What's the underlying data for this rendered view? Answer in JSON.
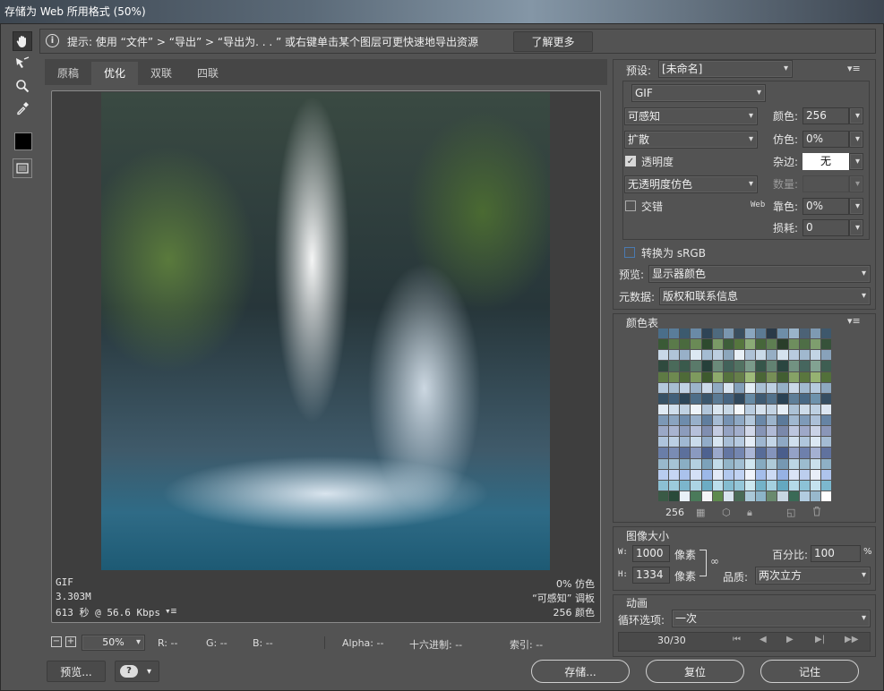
{
  "window": {
    "title": "存储为 Web 所用格式 (50%)"
  },
  "hint": {
    "text": "提示: 使用 “文件” > “导出” > “导出为. . . ” 或右键单击某个图层可更快速地导出资源",
    "learn_more": "了解更多"
  },
  "tabs": [
    "原稿",
    "优化",
    "双联",
    "四联"
  ],
  "image_info": {
    "format": "GIF",
    "size": "3.303M",
    "time": "613 秒 @ 56.6 Kbps",
    "dither": "0% 仿色",
    "palette": "“可感知” 调板",
    "colors": "256 颜色"
  },
  "statusbar": {
    "zoom": "50%",
    "r": "R: --",
    "g": "G: --",
    "b": "B: --",
    "alpha": "Alpha: --",
    "hex": "十六进制: --",
    "index": "索引: --"
  },
  "bottom_buttons": {
    "preview": "预览...",
    "save": "存储...",
    "reset": "复位",
    "remember": "记住"
  },
  "settings": {
    "preset_label": "预设:",
    "preset_value": "[未命名]",
    "format_value": "GIF",
    "reduction": "可感知",
    "dither_algo": "扩散",
    "transparency_label": "透明度",
    "transparency_checked": true,
    "trans_dither": "无透明度仿色",
    "interlace_label": "交错",
    "interlace_checked": false,
    "colors_label": "颜色:",
    "colors_value": "256",
    "dither_label": "仿色:",
    "dither_value": "0%",
    "matte_label": "杂边:",
    "matte_value": "无",
    "amount_label": "数量:",
    "amount_value": "",
    "websnap_prefix": "Web",
    "websnap_label": "靠色:",
    "websnap_value": "0%",
    "lossy_label": "损耗:",
    "lossy_value": "0",
    "convert_srgb": "转换为 sRGB",
    "convert_checked": false,
    "preview_label": "预览:",
    "preview_value": "显示器颜色",
    "metadata_label": "元数据:",
    "metadata_value": "版权和联系信息"
  },
  "color_table": {
    "title": "颜色表",
    "count": "256",
    "swatches": [
      "#4a6e8a",
      "#5a7d9a",
      "#3c5a6e",
      "#6a8aa6",
      "#2e4456",
      "#4e6a7e",
      "#7a96ae",
      "#3a4e5e",
      "#8aa6be",
      "#5c7a92",
      "#2a3a48",
      "#6e8ea8",
      "#9ab4ca",
      "#4c6276",
      "#7e9ab2",
      "#3e586c",
      "#3a5a36",
      "#5a7a4a",
      "#4a6a3e",
      "#6a8a56",
      "#2e4a2e",
      "#7a9a66",
      "#3e5e3a",
      "#56763e",
      "#8aaa76",
      "#46663a",
      "#5e7e52",
      "#2a3e2a",
      "#6e8e5e",
      "#4e6e46",
      "#7e9e6e",
      "#36523a",
      "#c8d8e8",
      "#b0c4d8",
      "#98b0c8",
      "#dce8f2",
      "#a4bcd2",
      "#bccee0",
      "#8ca6bc",
      "#e8f0f6",
      "#aec2d6",
      "#cadae8",
      "#96aec4",
      "#d4e2ee",
      "#b8cade",
      "#a0b8ce",
      "#c2d4e4",
      "#88a2ba",
      "#2f4a3e",
      "#4a6a5a",
      "#3a5a4c",
      "#5a7a6a",
      "#26403a",
      "#6a8a7a",
      "#42625a",
      "#527262",
      "#7a9a8a",
      "#36564a",
      "#628272",
      "#2a4640",
      "#729282",
      "#46665e",
      "#82a292",
      "#3e5e52",
      "#5e7a44",
      "#6e8a50",
      "#4e6a38",
      "#7e9a5e",
      "#3e5a2e",
      "#8eaa6c",
      "#56723e",
      "#667e4a",
      "#9eba7a",
      "#4a6636",
      "#768e56",
      "#425e32",
      "#86a266",
      "#5a763e",
      "#96b272",
      "#52703a",
      "#b4c8dc",
      "#a8bed2",
      "#c0d2e4",
      "#9cb4ca",
      "#ccdaea",
      "#90aac2",
      "#d8e4f0",
      "#84a0ba",
      "#e4eef6",
      "#aac0d4",
      "#bed0e2",
      "#96b0c6",
      "#cad8e8",
      "#a2bad0",
      "#b6cade",
      "#8ea8c0",
      "#365064",
      "#42607a",
      "#2c4658",
      "#4e6e88",
      "#3a566c",
      "#5a7a94",
      "#466480",
      "#30485c",
      "#668aa4",
      "#3e5a72",
      "#52728c",
      "#2a4254",
      "#5e7e98",
      "#486884",
      "#6e92ac",
      "#364e62",
      "#e0eaf4",
      "#d0deec",
      "#c0d2e2",
      "#eef4fa",
      "#b2c6da",
      "#dae6f0",
      "#c8d8e6",
      "#f4f8fc",
      "#bacde0",
      "#d6e2ee",
      "#c4d4e4",
      "#e6eef6",
      "#acc2d6",
      "#cedcea",
      "#bed0e2",
      "#dce6f2",
      "#7c98b6",
      "#8aa4c0",
      "#6e8cac",
      "#98b0ca",
      "#607e9e",
      "#a6bcd4",
      "#7692b2",
      "#8ea8c4",
      "#b4c8dc",
      "#6a88a8",
      "#9cb4cc",
      "#5c7a9a",
      "#a0b8d0",
      "#7e9ab8",
      "#acc0d8",
      "#6684a4",
      "#9aa8c6",
      "#a8b4d0",
      "#8c9cbc",
      "#b6c0da",
      "#808eb0",
      "#c4cce2",
      "#94a2c2",
      "#a2aecc",
      "#d2d8ea",
      "#8694b6",
      "#b0bad6",
      "#7a88aa",
      "#bcc6de",
      "#9ea8c8",
      "#cad2e6",
      "#8a96b8",
      "#aec4dc",
      "#bcd0e4",
      "#a0b8d2",
      "#cadcec",
      "#92acc8",
      "#d8e6f2",
      "#a8bed6",
      "#b6cae0",
      "#e6eef8",
      "#9eb6d0",
      "#c4d6e8",
      "#8ea8c4",
      "#d0e0ee",
      "#b0c6dc",
      "#dce8f4",
      "#a4bcd4",
      "#6a7ea8",
      "#7a8cb4",
      "#5c709c",
      "#8a9ac0",
      "#4e6290",
      "#9aa8cc",
      "#6476a2",
      "#7486b0",
      "#aab6d6",
      "#586c98",
      "#8494bc",
      "#4a5e8c",
      "#94a2c6",
      "#6e80ac",
      "#a4b0d2",
      "#60729e",
      "#98b8cc",
      "#a6c4d6",
      "#8aaec4",
      "#b4d0e0",
      "#7ca2ba",
      "#c2dcea",
      "#92b4c8",
      "#a0bed2",
      "#d0e6f0",
      "#86aac0",
      "#aecad8",
      "#7698b2",
      "#bcd6e4",
      "#9cbccf",
      "#cae0ec",
      "#8eb0c6",
      "#b8ccf0",
      "#c6d6f4",
      "#aac2ec",
      "#d4e0f6",
      "#9cb8e8",
      "#e2eaf8",
      "#b2c8ee",
      "#c0d2f2",
      "#f0f4fc",
      "#a4bdea",
      "#ccdaf4",
      "#96b2e4",
      "#dae4f6",
      "#bcceee",
      "#e8eef8",
      "#aec4ec",
      "#8cc0d4",
      "#9ccadc",
      "#7cb6cc",
      "#acd4e4",
      "#6cacc4",
      "#bcdeec",
      "#84bcd0",
      "#94c6d8",
      "#cce8f0",
      "#74b2c8",
      "#a4d0e0",
      "#64a8c0",
      "#b4dae8",
      "#8cc2d6",
      "#c4e2ee",
      "#7cb8ce",
      "#3a5a46",
      "#2a4a3a",
      "#e8f0f8",
      "#4a7a5a",
      "#f4f4f8",
      "#5e8a4e",
      "#d8e4ee",
      "#4a6a56",
      "#aac8d8",
      "#8cb4c8",
      "#6a8a6e",
      "#c8d6e2",
      "#3a6a56",
      "#b2cce0",
      "#98b8cc",
      "#ffffff"
    ]
  },
  "image_size": {
    "title": "图像大小",
    "w_label": "W:",
    "w_value": "1000",
    "w_unit": "像素",
    "h_label": "H:",
    "h_value": "1334",
    "h_unit": "像素",
    "percent_label": "百分比:",
    "percent_value": "100",
    "percent_unit": "%",
    "quality_label": "品质:",
    "quality_value": "两次立方"
  },
  "animation": {
    "title": "动画",
    "loop_label": "循环选项:",
    "loop_value": "一次",
    "frame": "30/30"
  },
  "colors": {
    "accent_check": "#4a7ab0"
  }
}
